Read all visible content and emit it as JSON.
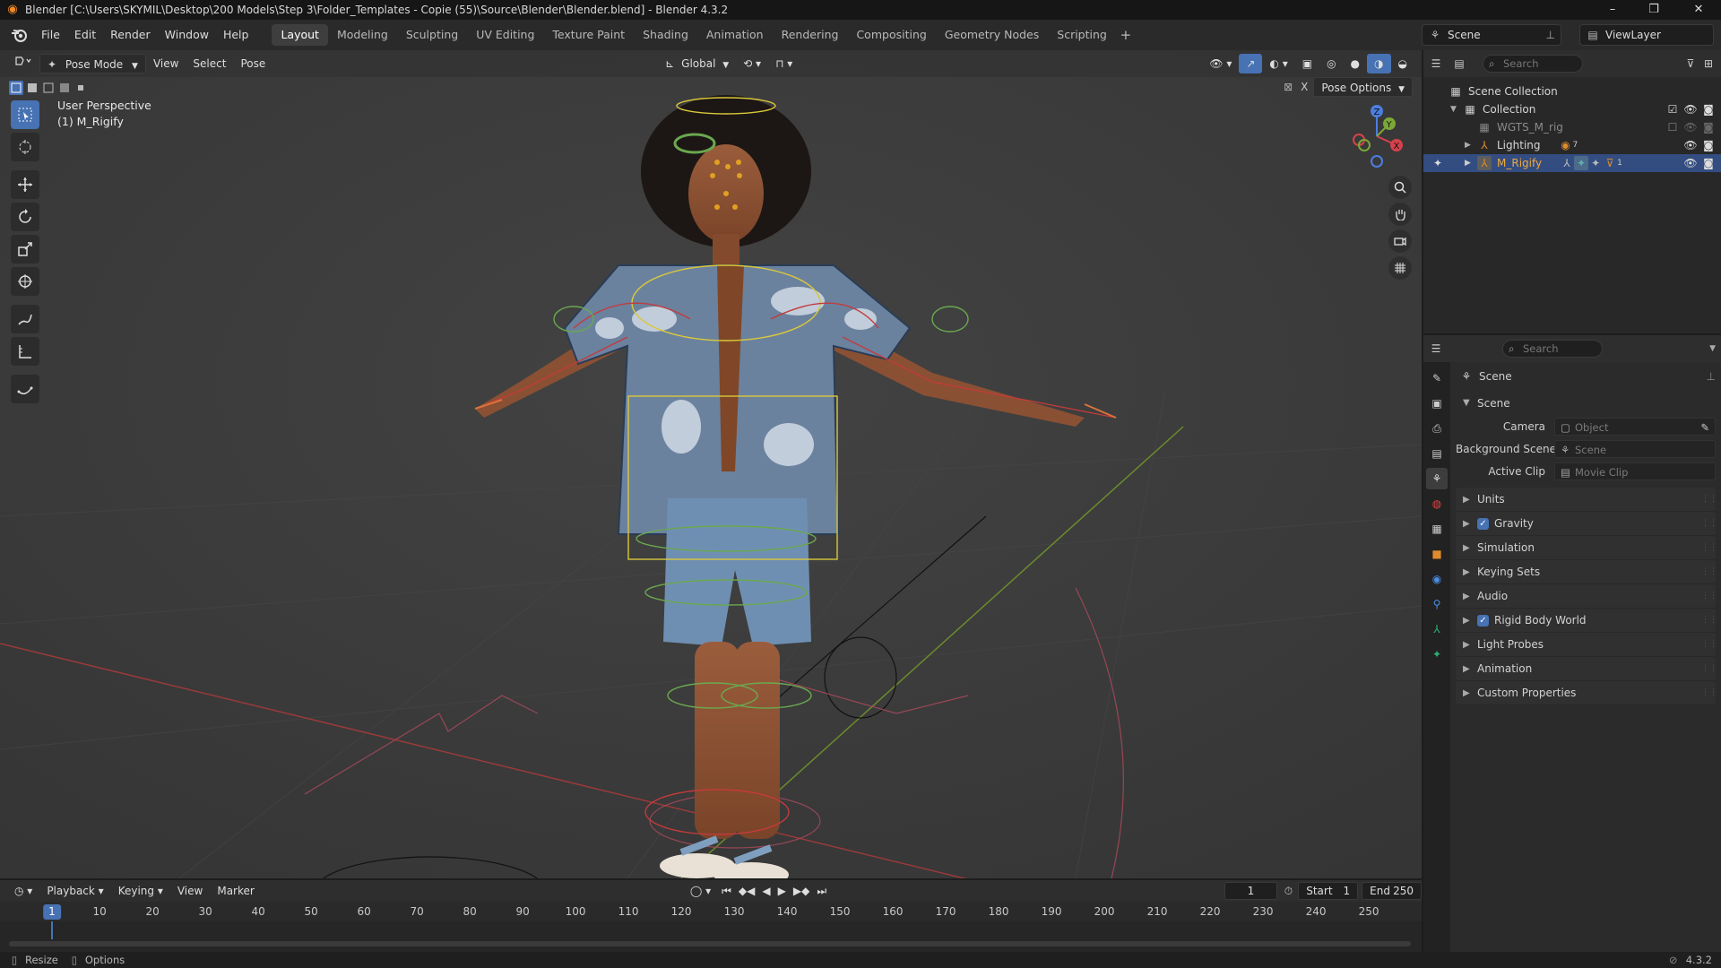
{
  "window": {
    "title": "Blender [C:\\Users\\SKYMIL\\Desktop\\200 Models\\Step 3\\Folder_Templates - Copie (55)\\Source\\Blender\\Blender.blend] - Blender 4.3.2",
    "minimize": "–",
    "maximize": "❐",
    "close": "✕"
  },
  "menu": {
    "items": [
      "File",
      "Edit",
      "Render",
      "Window",
      "Help"
    ]
  },
  "workspaces": {
    "tabs": [
      "Layout",
      "Modeling",
      "Sculpting",
      "UV Editing",
      "Texture Paint",
      "Shading",
      "Animation",
      "Rendering",
      "Compositing",
      "Geometry Nodes",
      "Scripting"
    ],
    "active": "Layout",
    "add": "+"
  },
  "scene_selector": {
    "scene": "Scene",
    "view_layer": "ViewLayer"
  },
  "viewport": {
    "mode": "Pose Mode",
    "menus": [
      "View",
      "Select",
      "Pose"
    ],
    "orientation": "Global",
    "overlay_line1": "User Perspective",
    "overlay_line2": "(1) M_Rigify",
    "pose_options": "Pose Options",
    "x_toggle": "X",
    "axis_x": "X",
    "axis_y": "Y",
    "axis_z": "Z"
  },
  "outliner": {
    "search_placeholder": "Search",
    "rows": [
      {
        "label": "Scene Collection",
        "indent": 0,
        "icon": "collection-icon"
      },
      {
        "label": "Collection",
        "indent": 1,
        "icon": "collection-icon"
      },
      {
        "label": "WGTS_M_rig",
        "indent": 2,
        "icon": "collection-icon"
      },
      {
        "label": "Lighting",
        "indent": 2,
        "icon": "armature-icon",
        "badge": "7"
      },
      {
        "label": "M_Rigify",
        "indent": 2,
        "icon": "armature-icon",
        "badge": "1"
      }
    ]
  },
  "properties": {
    "search_placeholder": "Search",
    "context": "Scene",
    "section": "Scene",
    "fields": [
      {
        "label": "Camera",
        "placeholder": "Object"
      },
      {
        "label": "Background Scene",
        "placeholder": "Scene"
      },
      {
        "label": "Active Clip",
        "placeholder": "Movie Clip"
      }
    ],
    "panels": [
      {
        "label": "Units",
        "checkbox": false
      },
      {
        "label": "Gravity",
        "checkbox": true
      },
      {
        "label": "Simulation",
        "checkbox": false
      },
      {
        "label": "Keying Sets",
        "checkbox": false
      },
      {
        "label": "Audio",
        "checkbox": false
      },
      {
        "label": "Rigid Body World",
        "checkbox": true
      },
      {
        "label": "Light Probes",
        "checkbox": false
      },
      {
        "label": "Animation",
        "checkbox": false
      },
      {
        "label": "Custom Properties",
        "checkbox": false
      }
    ]
  },
  "timeline": {
    "menus": [
      "Playback",
      "Keying",
      "View",
      "Marker"
    ],
    "current_frame": "1",
    "start_label": "Start",
    "start": "1",
    "end_label": "End",
    "end": "250",
    "ticks": [
      10,
      20,
      30,
      40,
      50,
      60,
      70,
      80,
      90,
      100,
      110,
      120,
      130,
      140,
      150,
      160,
      170,
      180,
      190,
      200,
      210,
      220,
      230,
      240,
      250
    ],
    "playhead": "1"
  },
  "status": {
    "left1": "Resize",
    "left2": "Options",
    "version": "4.3.2"
  }
}
